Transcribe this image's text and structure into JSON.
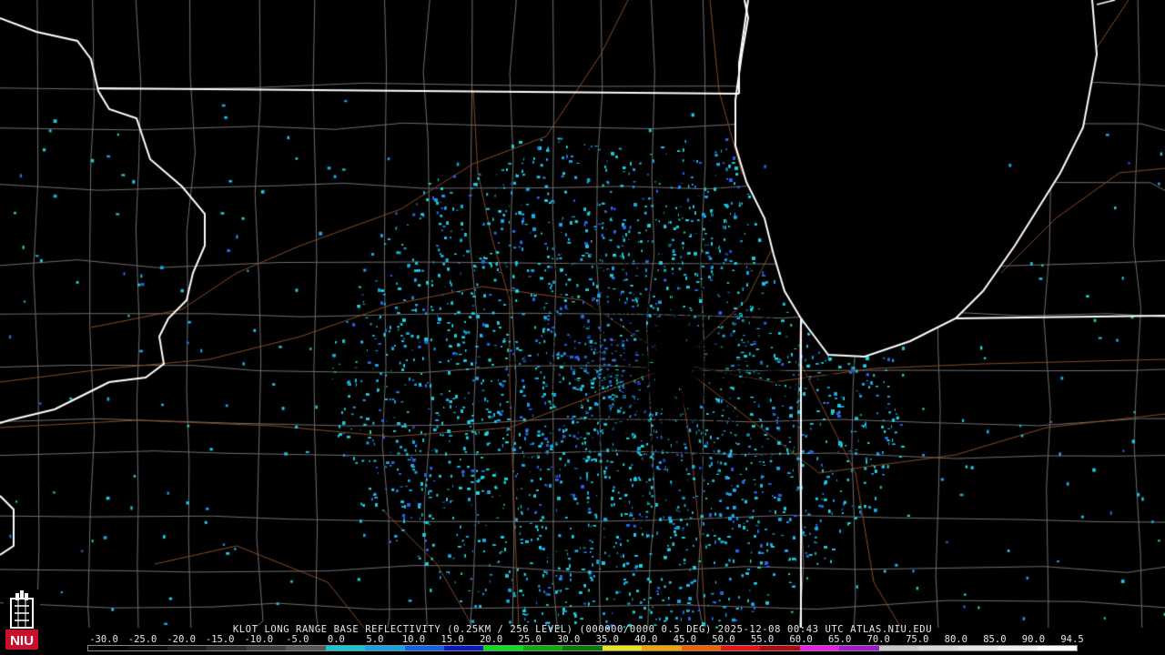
{
  "caption": "KLOT LONG RANGE BASE REFLECTIVITY (0.25KM / 256 LEVEL) (000000/0000 0.5 DEG) 2025-12-08 00:43 UTC  ATLAS.NIU.EDU",
  "legend": {
    "ticks": [
      "-30.0",
      "-25.0",
      "-20.0",
      "-15.0",
      "-10.0",
      "-5.0",
      "0.0",
      "5.0",
      "10.0",
      "15.0",
      "20.0",
      "25.0",
      "30.0",
      "35.0",
      "40.0",
      "45.0",
      "50.0",
      "55.0",
      "60.0",
      "65.0",
      "70.0",
      "75.0",
      "80.0",
      "85.0",
      "90.0",
      "94.5"
    ],
    "colors": [
      "#000000",
      "#0b0b0b",
      "#1a1a1a",
      "#2c2c2c",
      "#404040",
      "#585858",
      "#12c8d2",
      "#12a4e6",
      "#1060e8",
      "#0818c8",
      "#06e21c",
      "#08ae10",
      "#087a08",
      "#e8e41a",
      "#f0a400",
      "#f06200",
      "#e81414",
      "#b40808",
      "#ee1ae8",
      "#a21acc",
      "#c8c8c8",
      "#d8d8d8",
      "#e4e4e4",
      "#eeeeee",
      "#ffffff"
    ]
  },
  "colors": {
    "background": "#000000",
    "state_border": "#ffffff",
    "county_line": "#6e6e6e",
    "highway": "#8a4a26",
    "echo_light": "#1ec8dc",
    "echo_mid": "#18a4e6",
    "echo_strong": "#2a64e6"
  },
  "radar_site": "KLOT",
  "logo": {
    "text": "NIU",
    "color": "#c8102e"
  }
}
